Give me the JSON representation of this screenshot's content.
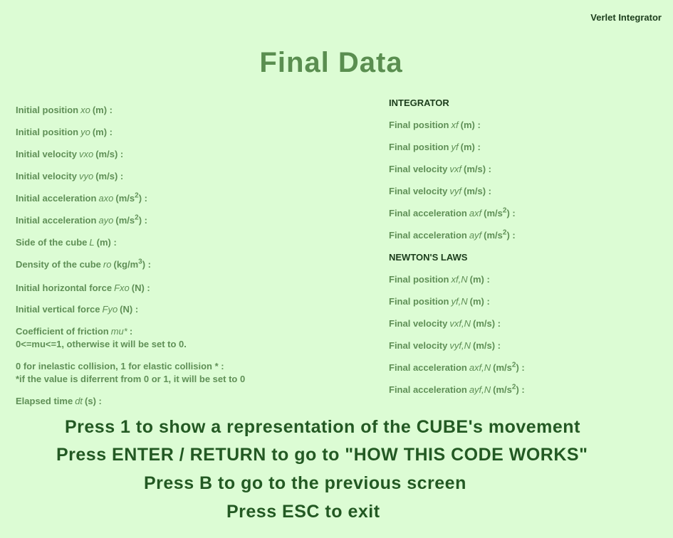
{
  "header": {
    "app_label": "Verlet Integrator",
    "title": "Final Data"
  },
  "initial": [
    {
      "pre": "Initial position",
      "sym": "xo",
      "post": "(m) :",
      "sup": "",
      "tail": ""
    },
    {
      "pre": "Initial position",
      "sym": "yo",
      "post": "(m) :",
      "sup": "",
      "tail": ""
    },
    {
      "pre": "Initial velocity",
      "sym": "vxo",
      "post": "(m/s) :",
      "sup": "",
      "tail": ""
    },
    {
      "pre": "Initial velocity",
      "sym": "vyo",
      "post": "(m/s) :",
      "sup": "",
      "tail": ""
    },
    {
      "pre": "Initial acceleration",
      "sym": "axo",
      "post": "(m/s",
      "sup": "2",
      "tail": ") :"
    },
    {
      "pre": "Initial acceleration",
      "sym": "ayo",
      "post": "(m/s",
      "sup": "2",
      "tail": ") :"
    },
    {
      "pre": "Side of the cube",
      "sym": "L",
      "post": "(m) :",
      "sup": "",
      "tail": ""
    },
    {
      "pre": "Density of the cube",
      "sym": "ro",
      "post": "(kg/m",
      "sup": "3",
      "tail": ") :"
    },
    {
      "pre": "Initial horizontal force",
      "sym": "Fxo",
      "post": "(N) :",
      "sup": "",
      "tail": ""
    },
    {
      "pre": "Initial vertical force",
      "sym": "Fyo",
      "post": "(N) :",
      "sup": "",
      "tail": ""
    }
  ],
  "friction": {
    "pre": "Coefficient of friction",
    "sym": "mu*",
    "post": ":",
    "note": "0<=mu<=1, otherwise it will be set to 0."
  },
  "collision": {
    "line1": "0 for inelastic collision, 1 for elastic collision * :",
    "note": "*if the value is diferrent from 0 or 1, it will be set to 0"
  },
  "elapsed": {
    "pre": "Elapsed time",
    "sym": "dt",
    "post": "(s) :"
  },
  "integrator": {
    "heading": "INTEGRATOR",
    "items": [
      {
        "pre": "Final position",
        "sym": "xf",
        "post": "(m) :",
        "sup": "",
        "tail": ""
      },
      {
        "pre": "Final position",
        "sym": "yf",
        "post": "(m) :",
        "sup": "",
        "tail": ""
      },
      {
        "pre": "Final velocity",
        "sym": "vxf",
        "post": "(m/s) :",
        "sup": "",
        "tail": ""
      },
      {
        "pre": "Final velocity",
        "sym": "vyf",
        "post": "(m/s) :",
        "sup": "",
        "tail": ""
      },
      {
        "pre": "Final acceleration",
        "sym": "axf",
        "post": "(m/s",
        "sup": "2",
        "tail": ") :"
      },
      {
        "pre": "Final acceleration",
        "sym": "ayf",
        "post": "(m/s",
        "sup": "2",
        "tail": ") :"
      }
    ]
  },
  "newton": {
    "heading": "NEWTON'S LAWS",
    "items": [
      {
        "pre": "Final position",
        "sym": "xf,N",
        "post": "(m) :",
        "sup": "",
        "tail": ""
      },
      {
        "pre": "Final position",
        "sym": "yf,N",
        "post": "(m) :",
        "sup": "",
        "tail": ""
      },
      {
        "pre": "Final velocity",
        "sym": "vxf,N",
        "post": "(m/s) :",
        "sup": "",
        "tail": ""
      },
      {
        "pre": "Final velocity",
        "sym": "vyf,N",
        "post": "(m/s) :",
        "sup": "",
        "tail": ""
      },
      {
        "pre": "Final acceleration",
        "sym": "axf,N",
        "post": "(m/s",
        "sup": "2",
        "tail": ") :"
      },
      {
        "pre": "Final acceleration",
        "sym": "ayf,N",
        "post": "(m/s",
        "sup": "2",
        "tail": ") :"
      }
    ]
  },
  "instructions": {
    "show_cube": "Press 1 to show a representation of the CUBE's movement",
    "how_it_works": "Press ENTER / RETURN to go to \"HOW THIS CODE WORKS\"",
    "previous": "Press B to go to the previous screen",
    "exit": "Press ESC to exit"
  }
}
